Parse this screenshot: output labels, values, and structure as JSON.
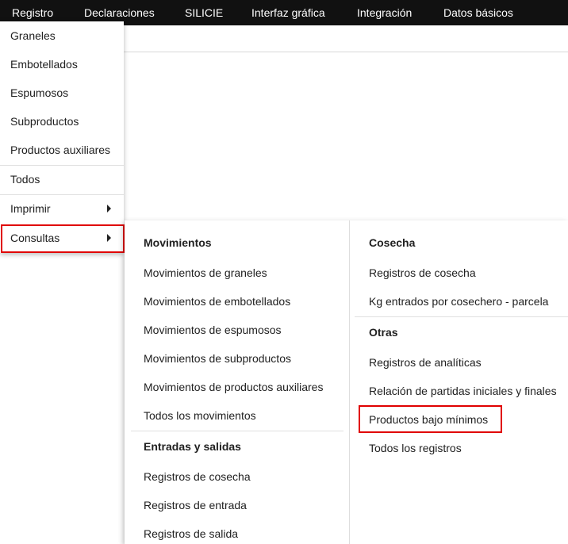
{
  "menubar": {
    "items": [
      "Registro",
      "Declaraciones",
      "SILICIE",
      "Interfaz gráfica",
      "Integración",
      "Datos básicos"
    ]
  },
  "dropdown": {
    "items": [
      "Graneles",
      "Embotellados",
      "Espumosos",
      "Subproductos",
      "Productos auxiliares",
      "Todos",
      "Imprimir",
      "Consultas"
    ]
  },
  "submenu": {
    "movimientos": {
      "title": "Movimientos",
      "items": [
        "Movimientos de graneles",
        "Movimientos de embotellados",
        "Movimientos de espumosos",
        "Movimientos de subproductos",
        "Movimientos de productos auxiliares",
        "Todos los movimientos"
      ]
    },
    "entradas_salidas": {
      "title": "Entradas y salidas",
      "items": [
        "Registros de cosecha",
        "Registros de entrada",
        "Registros de salida"
      ]
    },
    "cosecha": {
      "title": "Cosecha",
      "items": [
        "Registros de cosecha",
        "Kg entrados por cosechero - parcela"
      ]
    },
    "otras": {
      "title": "Otras",
      "items": [
        "Registros de analíticas",
        "Relación de partidas iniciales y finales",
        "Productos bajo mínimos",
        "Todos los registros"
      ]
    }
  },
  "colors": {
    "menubar_bg": "#111111",
    "highlight": "#e00000"
  }
}
